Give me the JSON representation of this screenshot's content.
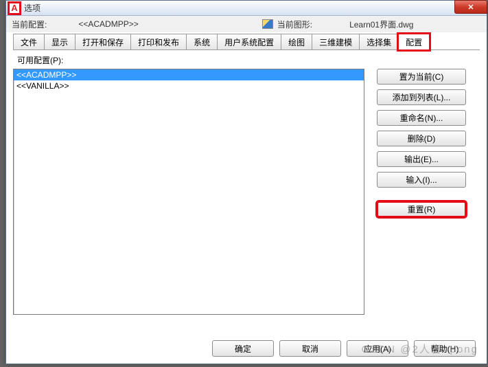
{
  "titlebar": {
    "app_icon_letter": "A",
    "title": "选项",
    "close_glyph": "✕"
  },
  "info": {
    "current_profile_label": "当前配置:",
    "current_profile_value": "<<ACADMPP>>",
    "current_drawing_label": "当前图形:",
    "current_drawing_value": "Learn01界面.dwg"
  },
  "tabs": [
    {
      "key": "file",
      "label": "文件"
    },
    {
      "key": "display",
      "label": "显示"
    },
    {
      "key": "open",
      "label": "打开和保存"
    },
    {
      "key": "print",
      "label": "打印和发布"
    },
    {
      "key": "system",
      "label": "系统"
    },
    {
      "key": "user",
      "label": "用户系统配置"
    },
    {
      "key": "draw",
      "label": "绘图"
    },
    {
      "key": "3d",
      "label": "三维建模"
    },
    {
      "key": "select",
      "label": "选择集"
    },
    {
      "key": "profile",
      "label": "配置"
    }
  ],
  "profiles_panel": {
    "available_label": "可用配置(P):",
    "items": [
      {
        "name": "<<ACADMPP>>",
        "selected": true
      },
      {
        "name": "<<VANILLA>>",
        "selected": false
      }
    ],
    "buttons": {
      "set_current": "置为当前(C)",
      "add_to_list": "添加到列表(L)...",
      "rename": "重命名(N)...",
      "delete": "删除(D)",
      "export": "输出(E)...",
      "import": "输入(I)...",
      "reset": "重置(R)"
    }
  },
  "dialog_buttons": {
    "ok": "确定",
    "cancel": "取消",
    "apply": "应用(A)",
    "help": "帮助(H)"
  },
  "watermark": "CSDN @2人音=pong"
}
